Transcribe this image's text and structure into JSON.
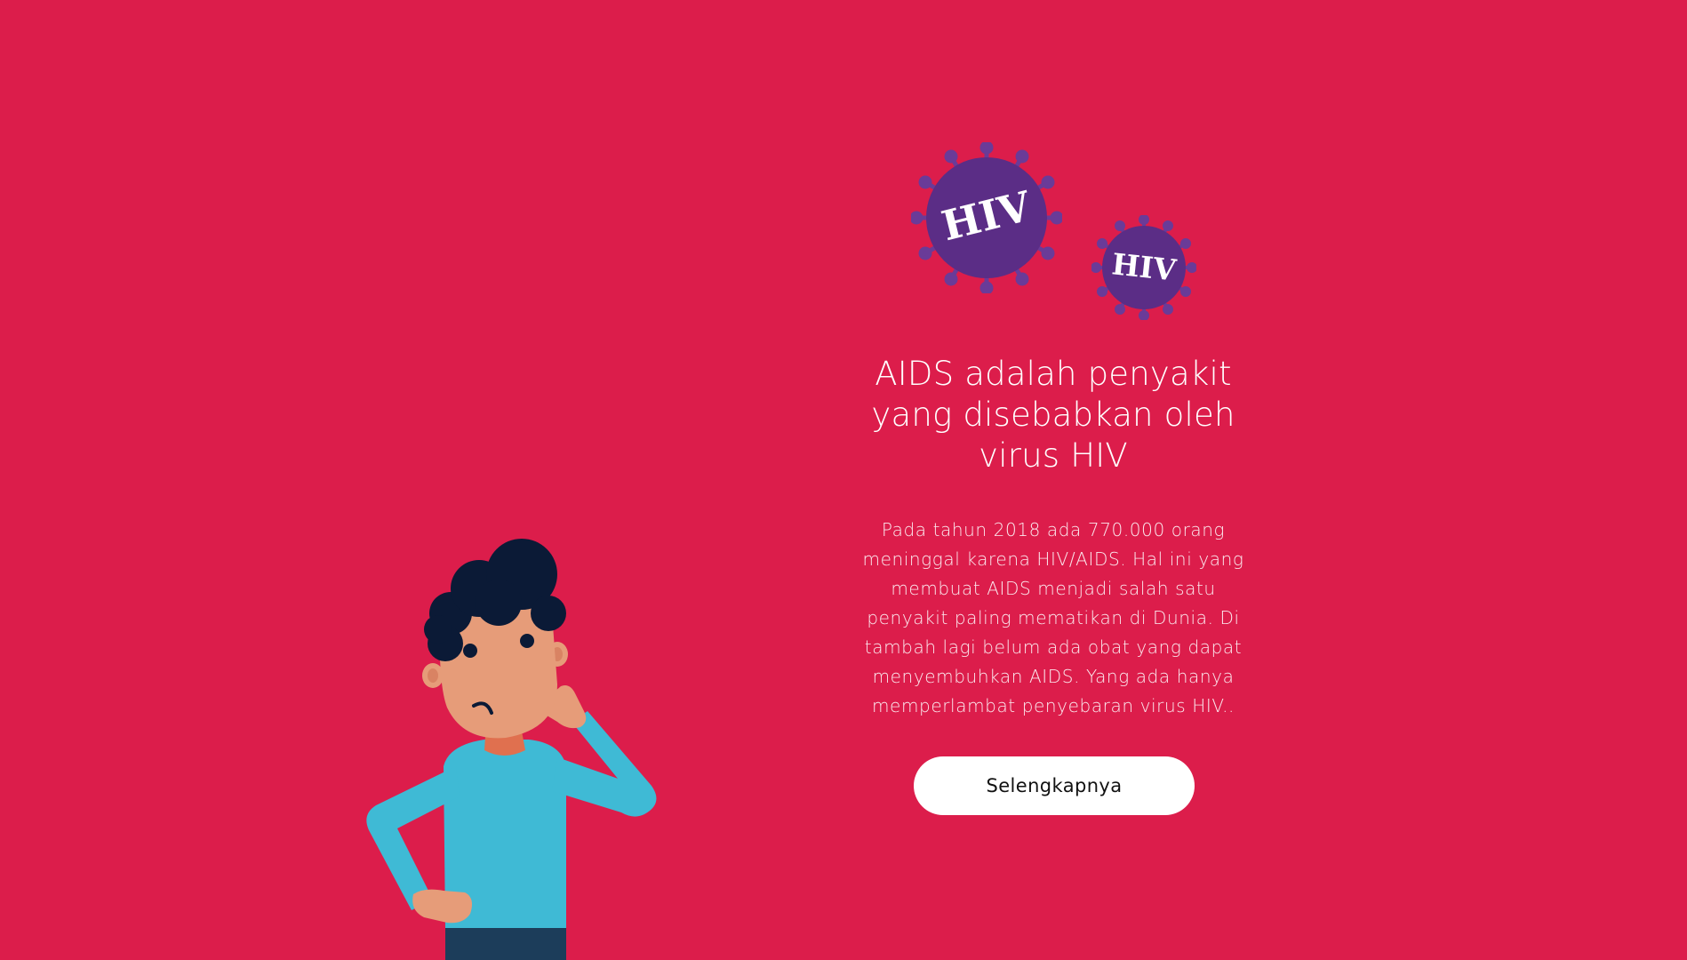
{
  "hero": {
    "headline": "AIDS adalah penyakit yang disebabkan oleh virus HIV",
    "body": "Pada tahun 2018 ada 770.000 orang meninggal karena HIV/AIDS. Hal ini yang membuat AIDS menjadi salah satu penyakit paling mematikan di Dunia. Di tambah lagi belum ada obat yang dapat menyembuhkan AIDS. Yang ada hanya memperlambat penyebaran virus HIV..",
    "cta_label": "Selengkapnya"
  },
  "viruses": {
    "large_label": "HIV",
    "small_label": "HIV"
  },
  "colors": {
    "background": "#DC1D4B",
    "virus": "#5B2D86",
    "virus_spike": "#6A3B98",
    "skin": "#E69C79",
    "hair": "#0B1A36",
    "shirt": "#3FBAD5",
    "pants": "#1C3D5A",
    "button_bg": "#FFFFFF"
  },
  "icons": {
    "character": "thinking-person-illustration",
    "virus": "hiv-virus-icon"
  }
}
